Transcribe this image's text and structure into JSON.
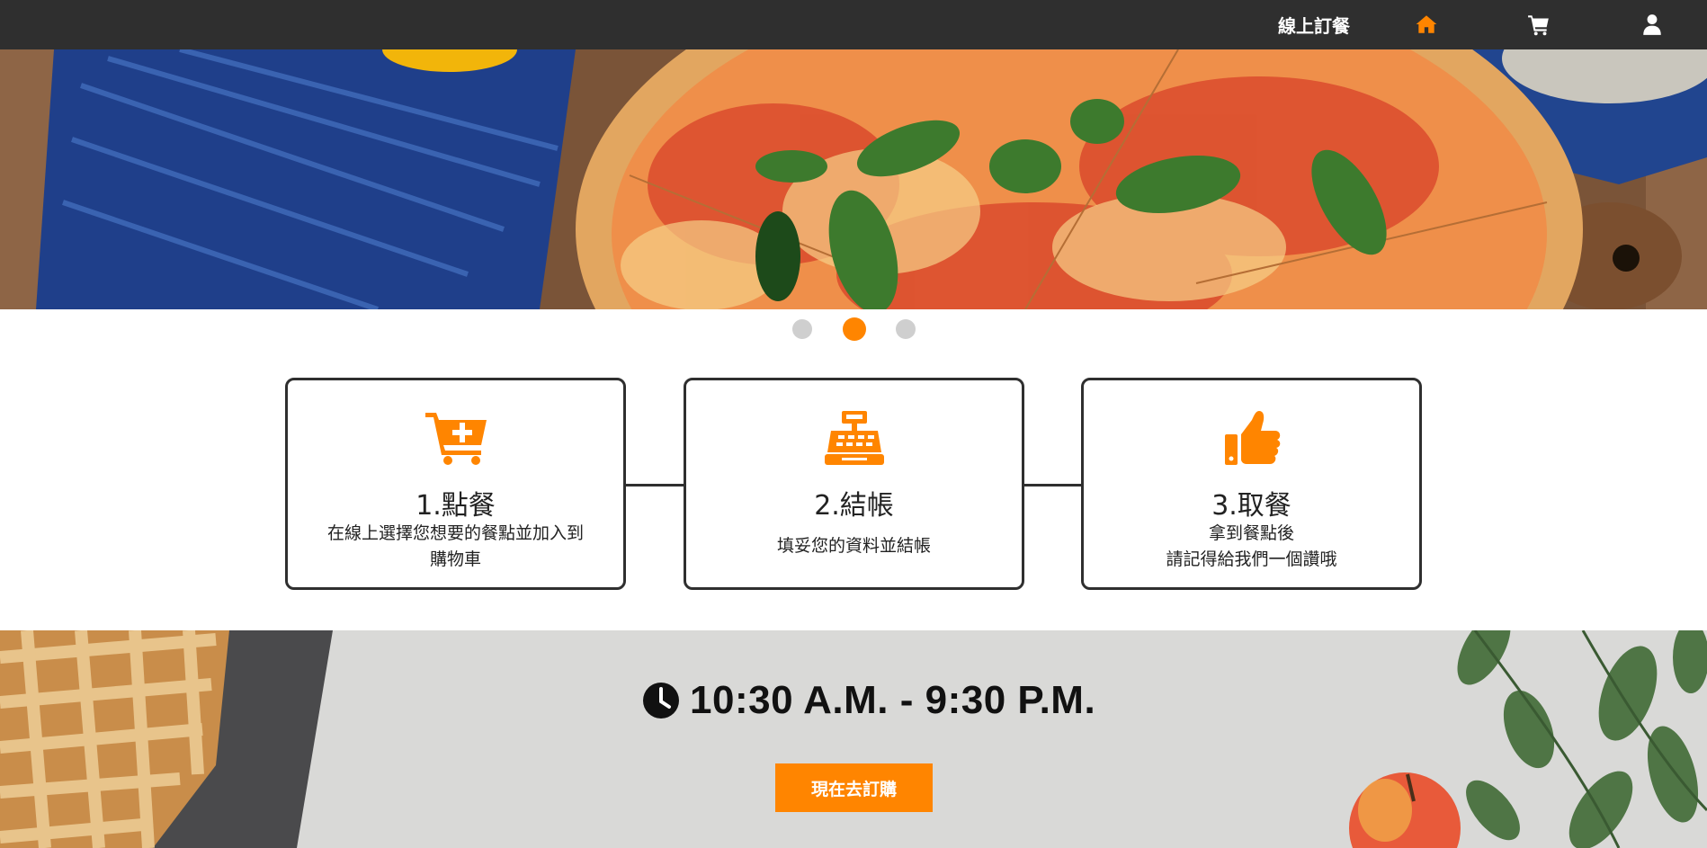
{
  "navbar": {
    "brand_label": "線上訂餐",
    "icons": [
      "home-icon",
      "cart-icon",
      "user-icon"
    ],
    "accent": "#ff8500",
    "background": "#2f2f2f"
  },
  "carousel": {
    "slide_count": 3,
    "active_index": 1
  },
  "steps": [
    {
      "icon": "cart-plus-icon",
      "title": "1.點餐",
      "desc": [
        "在線上選擇您想要的餐點並加入到",
        "購物車"
      ]
    },
    {
      "icon": "cash-register-icon",
      "title": "2.結帳",
      "desc": [
        "填妥您的資料並結帳"
      ]
    },
    {
      "icon": "thumbs-up-icon",
      "title": "3.取餐",
      "desc": [
        "拿到餐點後",
        "請記得給我們一個讚哦"
      ]
    }
  ],
  "hours": {
    "icon": "clock-icon",
    "text": "10:30 A.M. - 9:30 P.M."
  },
  "cta": {
    "label": "現在去訂購",
    "color": "#ff8500"
  }
}
